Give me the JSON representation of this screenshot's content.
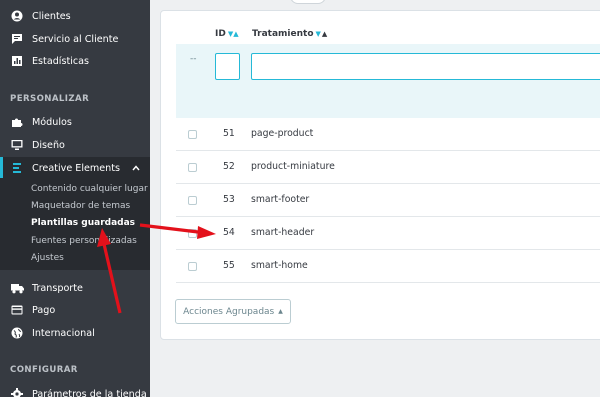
{
  "sidebar": {
    "items_top": [
      {
        "label": "Clientes",
        "icon": "user-circle-icon"
      },
      {
        "label": "Servicio al Cliente",
        "icon": "chat-icon"
      },
      {
        "label": "Estadísticas",
        "icon": "chart-icon"
      }
    ],
    "section_personalizar": "PERSONALIZAR",
    "items_personalizar": [
      {
        "label": "Módulos",
        "icon": "puzzle-icon"
      },
      {
        "label": "Diseño",
        "icon": "monitor-icon"
      },
      {
        "label": "Creative Elements",
        "icon": "creative-elements-icon"
      }
    ],
    "submenu": [
      {
        "label": "Contenido cualquier lugar"
      },
      {
        "label": "Maquetador de temas"
      },
      {
        "label": "Plantillas guardadas"
      },
      {
        "label": "Fuentes personalizadas"
      },
      {
        "label": "Ajustes"
      }
    ],
    "items_after": [
      {
        "label": "Transporte",
        "icon": "truck-icon"
      },
      {
        "label": "Pago",
        "icon": "card-icon"
      },
      {
        "label": "Internacional",
        "icon": "globe-icon"
      }
    ],
    "section_configurar": "CONFIGURAR",
    "items_config": [
      {
        "label": "Parámetros de la tienda",
        "icon": "settings-icon"
      }
    ]
  },
  "table": {
    "col_id": "ID",
    "col_name": "Tratamiento",
    "filter_dash": "--",
    "rows": [
      {
        "id": "51",
        "name": "page-product"
      },
      {
        "id": "52",
        "name": "product-miniature"
      },
      {
        "id": "53",
        "name": "smart-footer"
      },
      {
        "id": "54",
        "name": "smart-header"
      },
      {
        "id": "55",
        "name": "smart-home"
      }
    ],
    "bulk_label": "Acciones Agrupadas"
  },
  "colors": {
    "accent": "#25b9d7",
    "sidebar": "#363a41",
    "arrow": "#e3111b"
  }
}
